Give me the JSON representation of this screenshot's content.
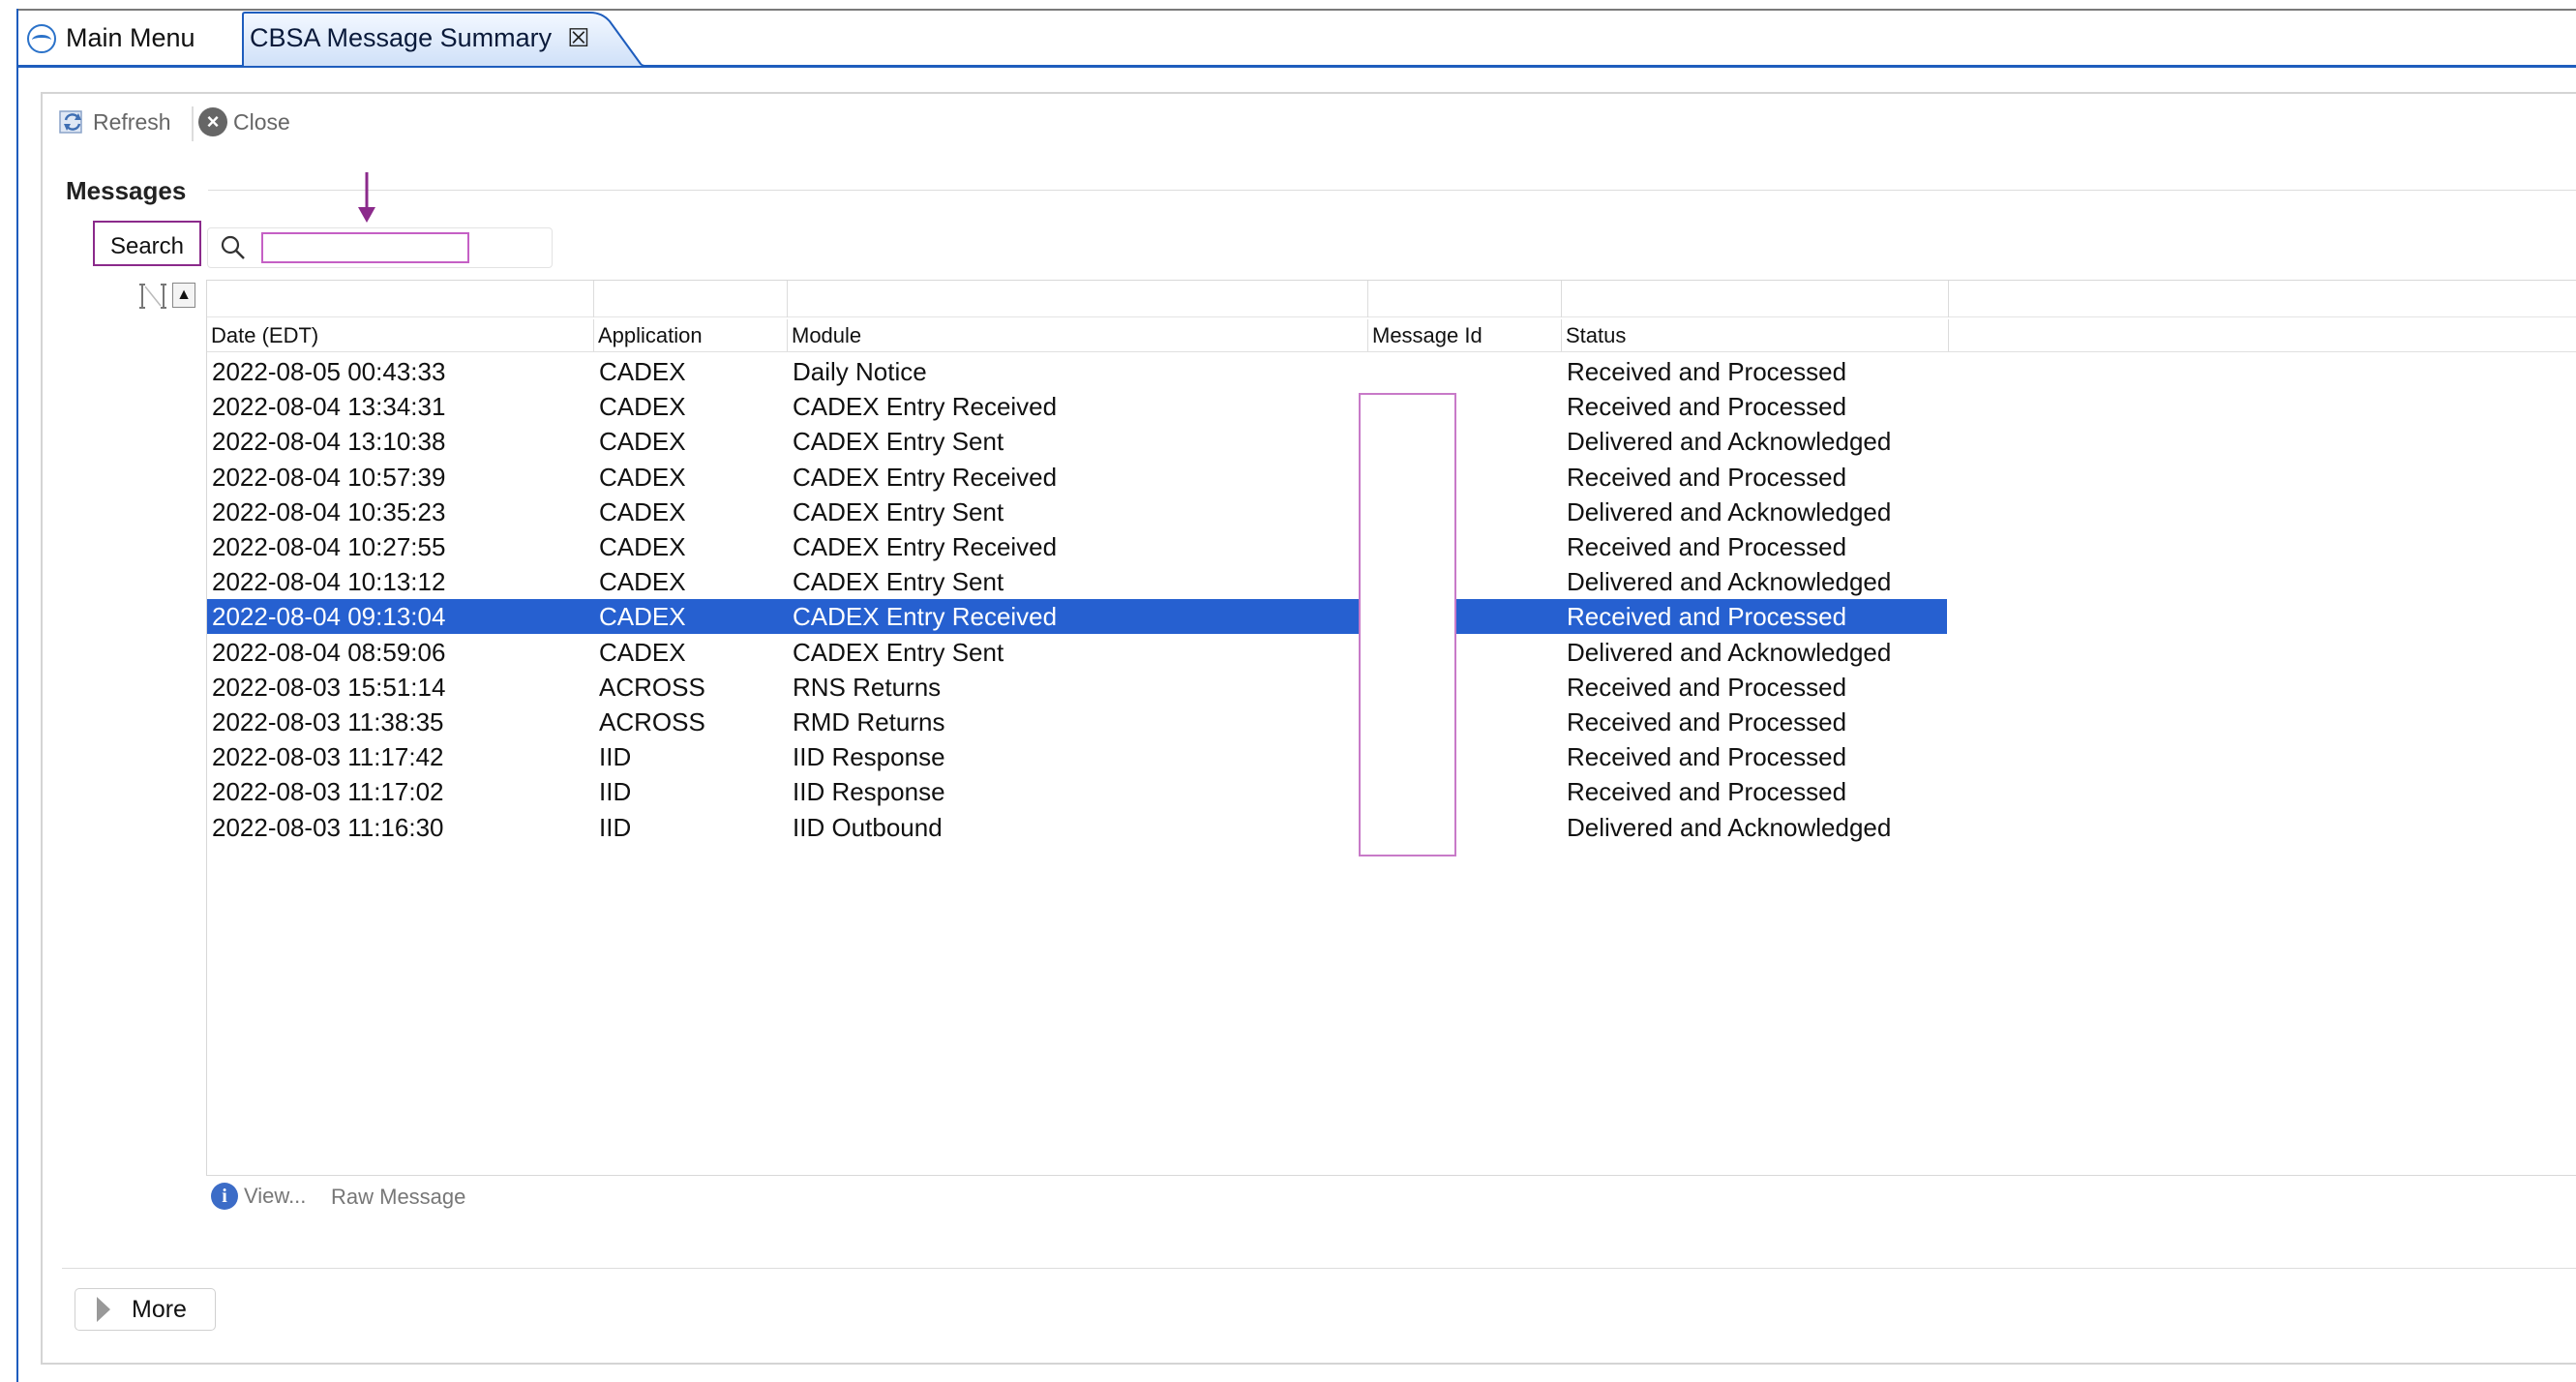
{
  "tabs": {
    "main_menu": "Main Menu",
    "cbsa": "CBSA Message Summary",
    "close_glyph": "☒"
  },
  "toolbar": {
    "refresh_label": "Refresh",
    "close_label": "Close"
  },
  "messages": {
    "title": "Messages",
    "search_label": "Search",
    "search_value": ""
  },
  "table": {
    "columns": [
      "Date (EDT)",
      "Application",
      "Module",
      "Message Id",
      "Status"
    ],
    "selected_index": 7,
    "rows": [
      {
        "date": "2022-08-05 00:43:33",
        "app": "CADEX",
        "module": "Daily Notice",
        "msgid": "",
        "status": "Received and Processed"
      },
      {
        "date": "2022-08-04 13:34:31",
        "app": "CADEX",
        "module": "CADEX Entry Received",
        "msgid": "",
        "status": "Received and Processed"
      },
      {
        "date": "2022-08-04 13:10:38",
        "app": "CADEX",
        "module": "CADEX Entry Sent",
        "msgid": "",
        "status": "Delivered and Acknowledged"
      },
      {
        "date": "2022-08-04 10:57:39",
        "app": "CADEX",
        "module": "CADEX Entry Received",
        "msgid": "",
        "status": "Received and Processed"
      },
      {
        "date": "2022-08-04 10:35:23",
        "app": "CADEX",
        "module": "CADEX Entry Sent",
        "msgid": "",
        "status": "Delivered and Acknowledged"
      },
      {
        "date": "2022-08-04 10:27:55",
        "app": "CADEX",
        "module": "CADEX Entry Received",
        "msgid": "",
        "status": "Received and Processed"
      },
      {
        "date": "2022-08-04 10:13:12",
        "app": "CADEX",
        "module": "CADEX Entry Sent",
        "msgid": "",
        "status": "Delivered and Acknowledged"
      },
      {
        "date": "2022-08-04 09:13:04",
        "app": "CADEX",
        "module": "CADEX Entry Received",
        "msgid": "",
        "status": "Received and Processed"
      },
      {
        "date": "2022-08-04 08:59:06",
        "app": "CADEX",
        "module": "CADEX Entry Sent",
        "msgid": "",
        "status": "Delivered and Acknowledged"
      },
      {
        "date": "2022-08-03 15:51:14",
        "app": "ACROSS",
        "module": "RNS Returns",
        "msgid": "",
        "status": "Received and Processed"
      },
      {
        "date": "2022-08-03 11:38:35",
        "app": "ACROSS",
        "module": "RMD Returns",
        "msgid": "",
        "status": "Received and Processed"
      },
      {
        "date": "2022-08-03 11:17:42",
        "app": "IID",
        "module": "IID Response",
        "msgid": "",
        "status": "Received and Processed"
      },
      {
        "date": "2022-08-03 11:17:02",
        "app": "IID",
        "module": "IID Response",
        "msgid": "",
        "status": "Received and Processed"
      },
      {
        "date": "2022-08-03 11:16:30",
        "app": "IID",
        "module": "IID Outbound",
        "msgid": "",
        "status": "Delivered and Acknowledged"
      }
    ]
  },
  "footer": {
    "view_label": "View...",
    "raw_label": "Raw Message",
    "more_label": "More"
  },
  "colors": {
    "selection": "#2660d0",
    "tab_accent": "#1e5dbd",
    "annotation": "#8b2a8b"
  }
}
